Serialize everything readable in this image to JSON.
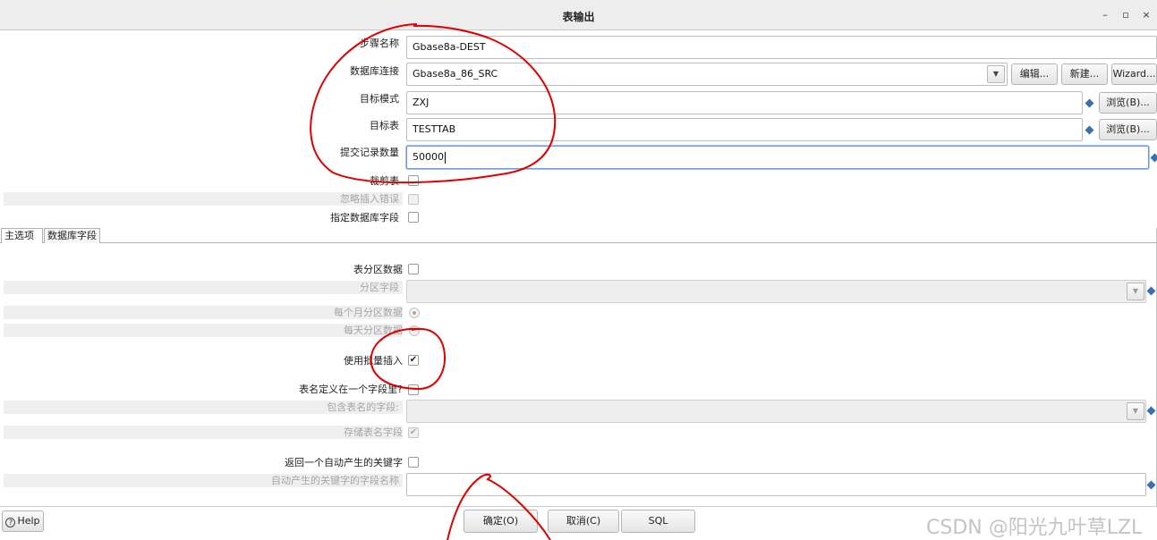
{
  "window": {
    "title": "表输出",
    "minimize": "–",
    "maximize": "▫",
    "close": "×"
  },
  "fields": {
    "step_name": {
      "label": "步骤名称",
      "value": "Gbase8a-DEST"
    },
    "db_connection": {
      "label": "数据库连接",
      "value": "Gbase8a_86_SRC",
      "edit": "编辑...",
      "new": "新建...",
      "wizard": "Wizard..."
    },
    "target_schema": {
      "label": "目标模式",
      "value": "ZXJ",
      "browse": "浏览(B)..."
    },
    "target_table": {
      "label": "目标表",
      "value": "TESTTAB",
      "browse": "浏览(B)..."
    },
    "commit_size": {
      "label": "提交记录数量",
      "value": "50000"
    },
    "truncate_table": {
      "label": "裁剪表",
      "checked": false
    },
    "ignore_insert_errors": {
      "label": "忽略插入错误",
      "checked": false,
      "disabled": true
    },
    "specify_db_fields": {
      "label": "指定数据库字段",
      "checked": false
    }
  },
  "tabs": [
    {
      "label": "主选项",
      "active": true
    },
    {
      "label": "数据库字段",
      "active": false
    }
  ],
  "main_options": {
    "partition_data": {
      "label": "表分区数据",
      "checked": false
    },
    "partition_field": {
      "label": "分区字段",
      "value": ""
    },
    "partition_monthly": {
      "label": "每个月分区数据",
      "selected": true
    },
    "partition_daily": {
      "label": "每天分区数据",
      "selected": false
    },
    "use_batch_insert": {
      "label": "使用批量插入",
      "checked": true
    },
    "tablename_in_field": {
      "label": "表名定义在一个字段里?",
      "checked": false
    },
    "tablename_field": {
      "label": "包含表名的字段:",
      "value": ""
    },
    "store_tablename_field": {
      "label": "存储表名字段",
      "checked": true
    },
    "return_auto_key": {
      "label": "返回一个自动产生的关键字",
      "checked": false
    },
    "auto_key_field_name": {
      "label": "自动产生的关键字的字段名称",
      "value": ""
    }
  },
  "footer": {
    "help": "Help",
    "ok": "确定(O)",
    "cancel": "取消(C)",
    "sql": "SQL"
  },
  "watermark": "CSDN @阳光九叶草LZL",
  "colors": {
    "annotation": "#e00000",
    "focus_border": "#6a98d8",
    "variable_diamond": "#3a6fb4"
  }
}
